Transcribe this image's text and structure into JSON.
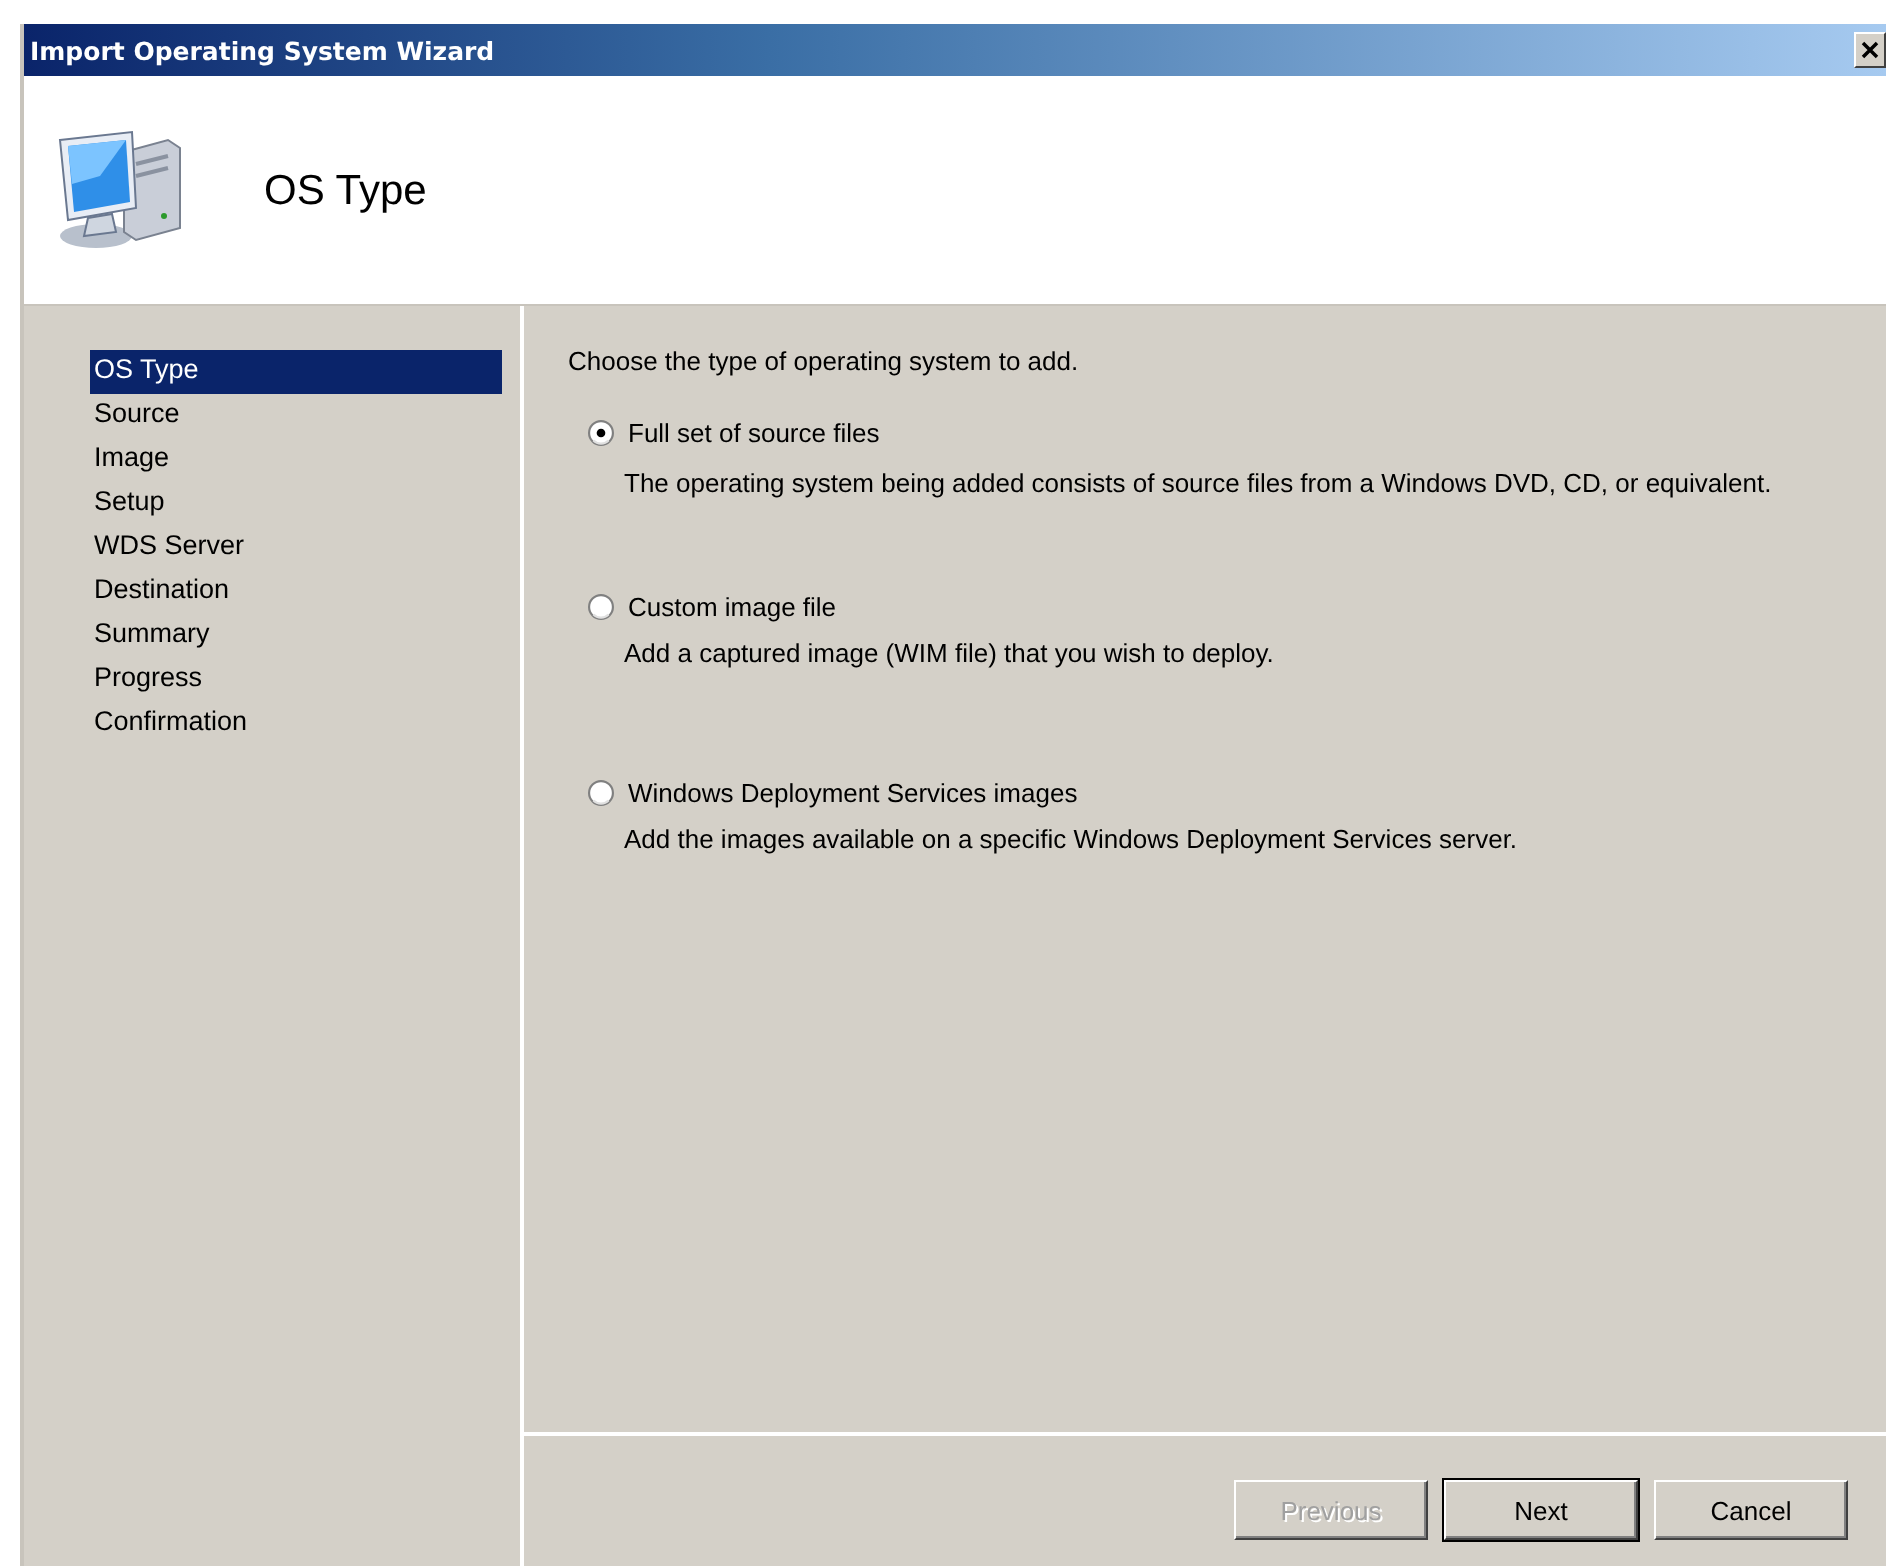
{
  "window": {
    "title": "Import Operating System Wizard"
  },
  "header": {
    "title": "OS Type"
  },
  "steps": [
    {
      "label": "OS Type",
      "selected": true
    },
    {
      "label": "Source",
      "selected": false
    },
    {
      "label": "Image",
      "selected": false
    },
    {
      "label": "Setup",
      "selected": false
    },
    {
      "label": "WDS Server",
      "selected": false
    },
    {
      "label": "Destination",
      "selected": false
    },
    {
      "label": "Summary",
      "selected": false
    },
    {
      "label": "Progress",
      "selected": false
    },
    {
      "label": "Confirmation",
      "selected": false
    }
  ],
  "prompt": "Choose the type of operating system to add.",
  "options": [
    {
      "label": "Full set of source files",
      "description": "The operating system being added consists of source files from a Windows DVD, CD, or equivalent.",
      "selected": true
    },
    {
      "label": "Custom image file",
      "description": "Add a captured image (WIM file) that you wish to deploy.",
      "selected": false
    },
    {
      "label": "Windows Deployment Services images",
      "description": "Add the images available on a specific Windows Deployment Services server.",
      "selected": false
    }
  ],
  "buttons": [
    {
      "label": "Previous",
      "disabled": true,
      "default": false
    },
    {
      "label": "Next",
      "disabled": false,
      "default": true
    },
    {
      "label": "Cancel",
      "disabled": false,
      "default": false
    }
  ]
}
